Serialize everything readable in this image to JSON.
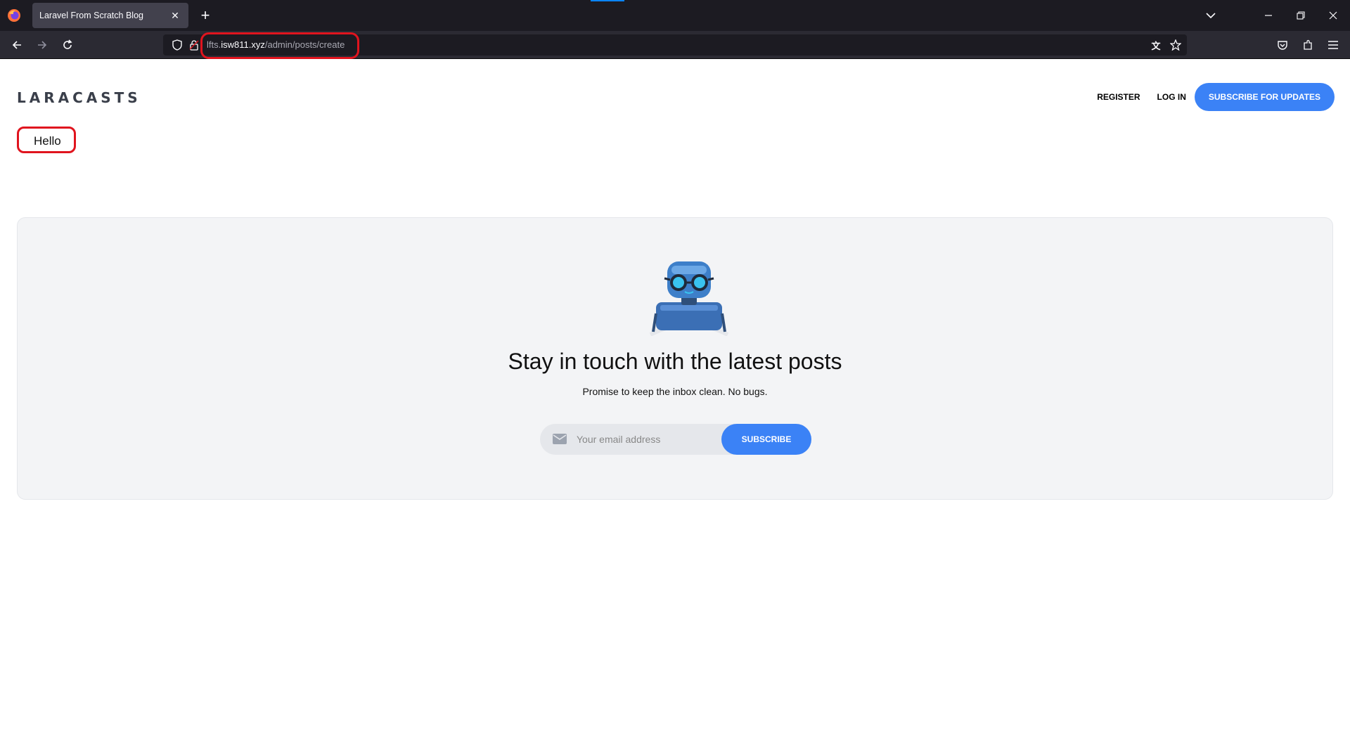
{
  "browser": {
    "tab_title": "Laravel From Scratch Blog",
    "url_prefix": "lfts.",
    "url_host": "isw811.xyz",
    "url_path": "/admin/posts/create"
  },
  "site": {
    "logo": "LARACASTS",
    "nav": {
      "register": "REGISTER",
      "login": "LOG IN",
      "subscribe": "SUBSCRIBE FOR UPDATES"
    },
    "main": {
      "message": "Hello"
    },
    "newsletter": {
      "title": "Stay in touch with the latest posts",
      "subtitle": "Promise to keep the inbox clean. No bugs.",
      "email_placeholder": "Your email address",
      "button": "SUBSCRIBE"
    }
  },
  "colors": {
    "accent": "#3b82f6",
    "annotation": "#e0141e"
  }
}
